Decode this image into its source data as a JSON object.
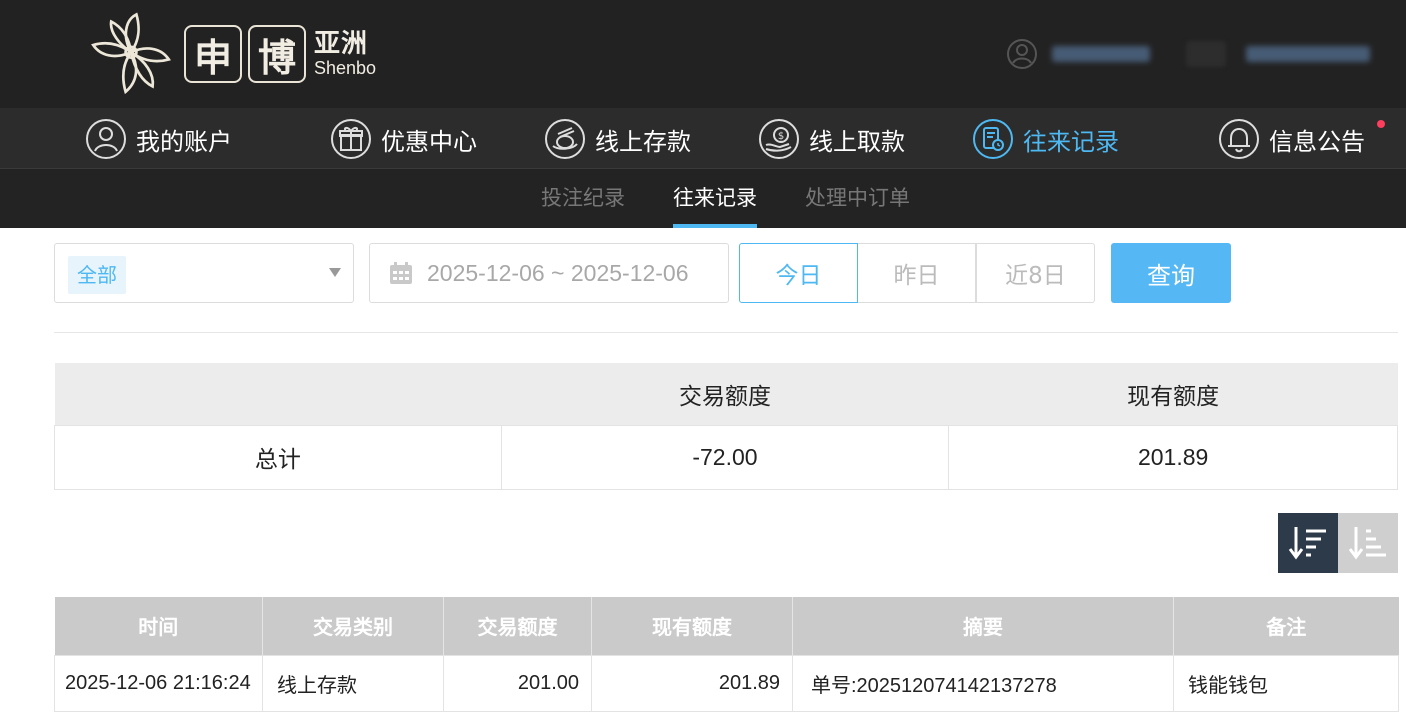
{
  "header": {
    "logo": {
      "box1": "申",
      "box2": "博",
      "cn": "亚洲",
      "en": "Shenbo"
    }
  },
  "nav": [
    {
      "label": "我的账户",
      "icon": "account-icon",
      "active": false
    },
    {
      "label": "优惠中心",
      "icon": "gift-icon",
      "active": false
    },
    {
      "label": "线上存款",
      "icon": "deposit-icon",
      "active": false
    },
    {
      "label": "线上取款",
      "icon": "withdraw-icon",
      "active": false
    },
    {
      "label": "往来记录",
      "icon": "records-icon",
      "active": true
    },
    {
      "label": "信息公告",
      "icon": "bell-icon",
      "active": false,
      "badge": true
    }
  ],
  "subnav": [
    {
      "label": "投注纪录",
      "active": false
    },
    {
      "label": "往来记录",
      "active": true
    },
    {
      "label": "处理中订单",
      "active": false
    }
  ],
  "filters": {
    "type_selected": "全部",
    "date_range": "2025-12-06 ~ 2025-12-06",
    "quick": [
      {
        "label": "今日",
        "active": true
      },
      {
        "label": "昨日",
        "active": false
      },
      {
        "label": "近8日",
        "active": false
      }
    ],
    "query_label": "查询"
  },
  "summary": {
    "headers": [
      "",
      "交易额度",
      "现有额度"
    ],
    "row": {
      "label": "总计",
      "amount": "-72.00",
      "balance": "201.89"
    }
  },
  "records": {
    "headers": [
      "时间",
      "交易类别",
      "交易额度",
      "现有额度",
      "摘要",
      "备注"
    ],
    "rows": [
      {
        "time": "2025-12-06 21:16:24",
        "type": "线上存款",
        "amount": "201.00",
        "balance": "201.89",
        "summary": "单号:202512074142137278",
        "note": "钱能钱包"
      }
    ]
  },
  "colors": {
    "accent": "#4eb8f2",
    "header_bg": "#222222",
    "badge": "#ff3e5e",
    "sort_active": "#2d3a4a"
  }
}
